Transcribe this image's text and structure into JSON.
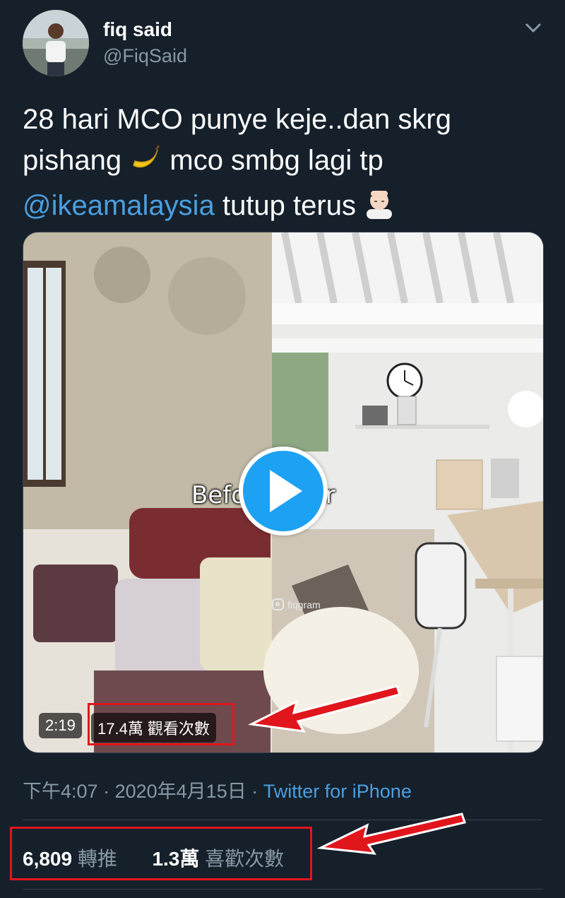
{
  "author": {
    "name": "fiq said",
    "handle": "@FiqSaid"
  },
  "tweet": {
    "text_part1": "28 hari MCO punye keje..dan skrg pishang",
    "text_part2": "mco smbg lagi tp",
    "mention": "@ikeamalaysia",
    "text_part3": "tutup terus"
  },
  "media": {
    "overlay_caption": "Before After",
    "watermark": "fiqgram",
    "duration": "2:19",
    "views": "17.4萬 觀看次數"
  },
  "meta": {
    "time": "下午4:07",
    "separator": "·",
    "date": "2020年4月15日",
    "source": "Twitter for iPhone"
  },
  "stats": {
    "retweets_count": "6,809",
    "retweets_label": "轉推",
    "likes_count": "1.3萬",
    "likes_label": "喜歡次數"
  },
  "colors": {
    "background": "#15202b",
    "accent": "#1da1f2",
    "link": "#4a9fe0",
    "secondary_text": "#8899a6",
    "annotation_red": "#e0161c"
  },
  "icons": [
    "chevron-down-icon",
    "banana-emoji",
    "face-palm-emoji",
    "play-icon",
    "instagram-icon",
    "red-arrow"
  ]
}
